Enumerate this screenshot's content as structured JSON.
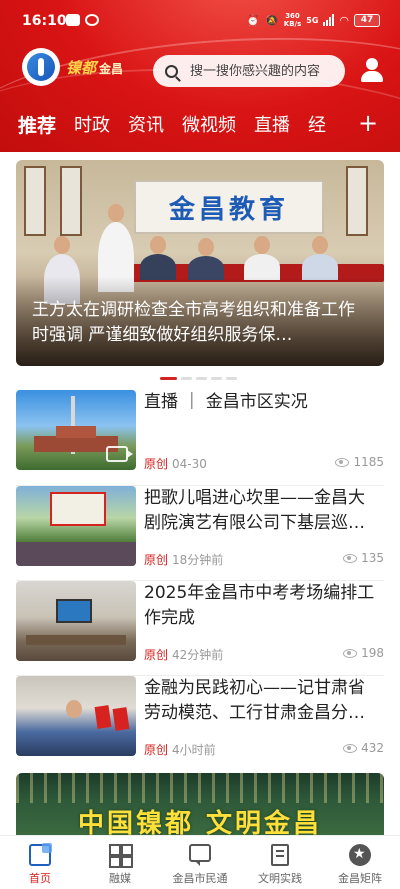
{
  "status_bar": {
    "time": "16:10",
    "net_speed_value": "360",
    "net_speed_unit": "KB/s",
    "network": "5G",
    "battery": "47"
  },
  "header": {
    "logo_text": "镍都",
    "logo_city": "金昌",
    "search_placeholder": "搜一搜你感兴趣的内容"
  },
  "tabs": [
    {
      "label": "推荐",
      "active": true
    },
    {
      "label": "时政"
    },
    {
      "label": "资讯"
    },
    {
      "label": "微视频"
    },
    {
      "label": "直播"
    },
    {
      "label": "经"
    }
  ],
  "tab_plus": "+",
  "banner": {
    "board_text": "金昌教育",
    "caption": "王方太在调研检查全市高考组织和准备工作时强调 严谨细致做好组织服务保…"
  },
  "news": [
    {
      "title": "直播 ｜ 金昌市区实况",
      "tag": "原创",
      "time": "04-30",
      "views": "1185"
    },
    {
      "title": "把歌儿唱进心坎里——金昌大剧院演艺有限公司下基层巡…",
      "tag": "原创",
      "time": "18分钟前",
      "views": "135"
    },
    {
      "title": "2025年金昌市中考考场编排工作完成",
      "tag": "原创",
      "time": "42分钟前",
      "views": "198"
    },
    {
      "title": "金融为民践初心——记甘肃省劳动模范、工行甘肃金昌分…",
      "tag": "原创",
      "time": "4小时前",
      "views": "432"
    }
  ],
  "promo": {
    "text": "中国镍都 文明金昌"
  },
  "bottom_nav": [
    {
      "label": "首页",
      "icon": "home-icon",
      "active": true
    },
    {
      "label": "融媒",
      "icon": "grid-icon"
    },
    {
      "label": "金昌市民通",
      "icon": "chat-icon"
    },
    {
      "label": "文明实践",
      "icon": "doc-icon"
    },
    {
      "label": "金昌矩阵",
      "icon": "star-icon"
    }
  ],
  "colors": {
    "brand_red": "#d91414",
    "accent_red": "#d6231f",
    "logo_gold": "#ffd34a",
    "nav_active_blue": "#1f5fbf"
  }
}
